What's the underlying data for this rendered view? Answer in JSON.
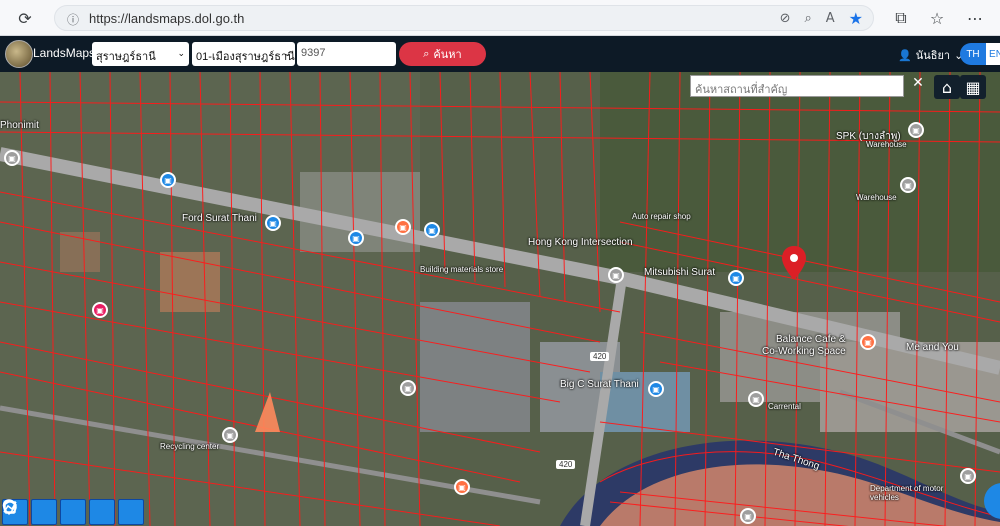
{
  "browser": {
    "url": "https://landsmaps.dol.go.th"
  },
  "header": {
    "app_title": "LandsMaps",
    "province": "สุราษฎร์ธานี",
    "district": "01-เมืองสุราษฎร์ธานี",
    "parcel_number": "9397",
    "search_label": "ค้นหา",
    "user_name": "นันธิยา",
    "lang_th": "TH",
    "lang_en": "EN"
  },
  "map": {
    "place_search_placeholder": "ค้นหาสถานที่สำคัญ",
    "road_numbers": [
      "420",
      "420"
    ],
    "labels": [
      "Ford Surat Thani",
      "Hong Kong Intersection",
      "Mitsubishi Surat",
      "Building materials store",
      "Auto repair shop",
      "Balance Cafe &",
      "Co-Working Space",
      "Me and You",
      "Big C Surat Thani",
      "Tha Thong",
      "SPK (บางลำพู)",
      "Warehouse",
      "Warehouse",
      "Department of motor vehicles",
      "Carrental",
      "Recycling center",
      "Phonimit"
    ],
    "accent_color": "#dc3545",
    "parcel_line_color": "#ff1a1a"
  }
}
